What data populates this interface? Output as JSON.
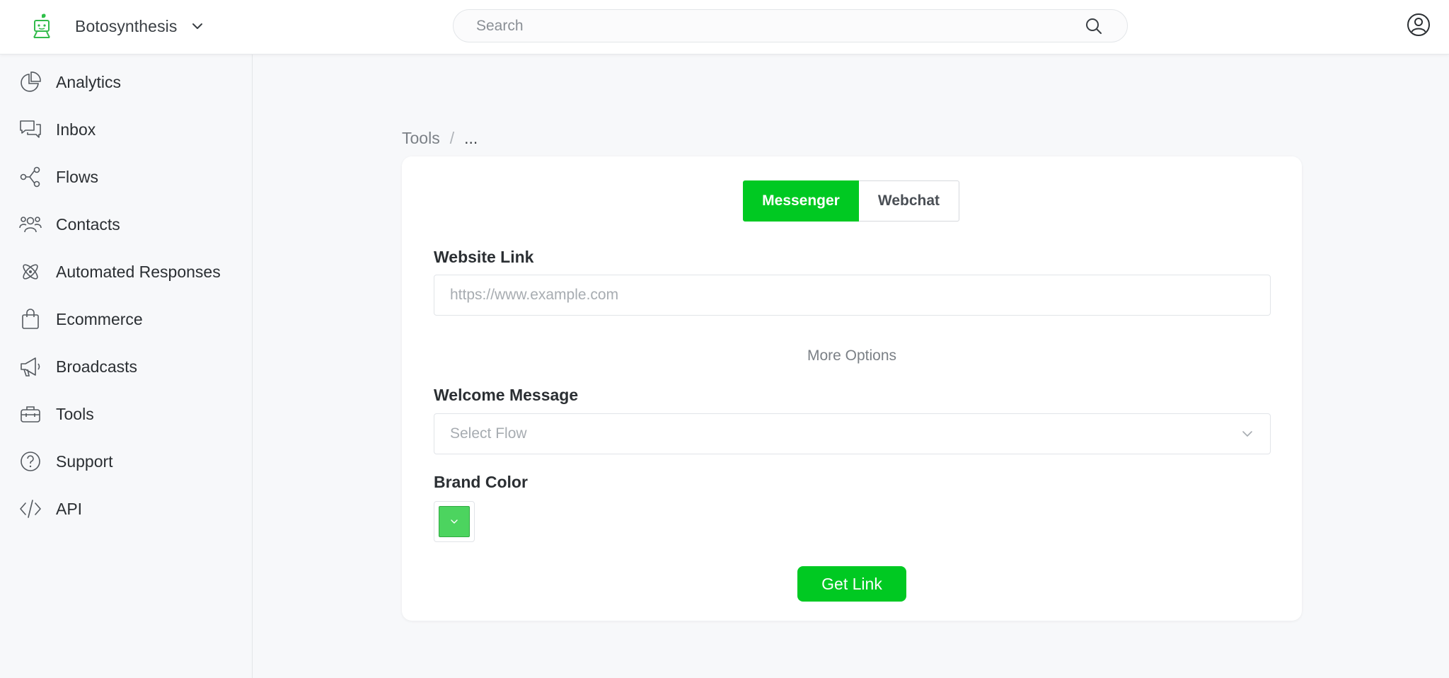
{
  "header": {
    "brand_name": "Botosynthesis",
    "search_placeholder": "Search"
  },
  "sidebar": {
    "items": [
      {
        "label": "Analytics",
        "icon": "pie-chart-icon"
      },
      {
        "label": "Inbox",
        "icon": "chat-bubbles-icon"
      },
      {
        "label": "Flows",
        "icon": "flow-nodes-icon"
      },
      {
        "label": "Contacts",
        "icon": "people-icon"
      },
      {
        "label": "Automated Responses",
        "icon": "atom-icon"
      },
      {
        "label": "Ecommerce",
        "icon": "shopping-bag-icon"
      },
      {
        "label": "Broadcasts",
        "icon": "megaphone-icon"
      },
      {
        "label": "Tools",
        "icon": "toolbox-icon"
      },
      {
        "label": "Support",
        "icon": "question-circle-icon"
      },
      {
        "label": "API",
        "icon": "code-icon"
      }
    ]
  },
  "breadcrumb": {
    "root": "Tools",
    "separator": "/",
    "current": "..."
  },
  "card": {
    "tabs": [
      {
        "label": "Messenger",
        "active": true
      },
      {
        "label": "Webchat",
        "active": false
      }
    ],
    "website_link": {
      "label": "Website Link",
      "placeholder": "https://www.example.com",
      "value": ""
    },
    "more_options": "More Options",
    "welcome_message": {
      "label": "Welcome Message",
      "placeholder": "Select Flow"
    },
    "brand_color": {
      "label": "Brand Color",
      "value": "#4cd45f"
    },
    "get_link_label": "Get Link"
  },
  "colors": {
    "accent": "#00c922",
    "swatch": "#4cd45f"
  }
}
